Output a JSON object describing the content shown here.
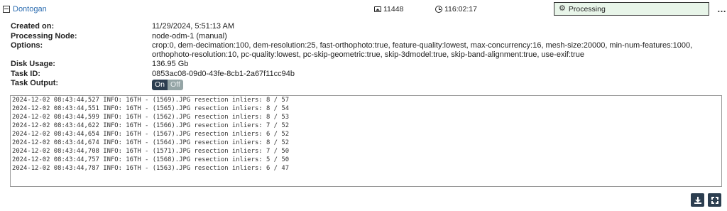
{
  "header": {
    "task_name": "Dontogan",
    "images_count": "11448",
    "elapsed": "116:02:17",
    "status": "Processing",
    "more_icon": "…"
  },
  "details": {
    "created_label": "Created on:",
    "created_value": "11/29/2024, 5:51:13 AM",
    "node_label": "Processing Node:",
    "node_value": "node-odm-1 (manual)",
    "options_label": "Options:",
    "options_value": "crop:0, dem-decimation:100, dem-resolution:25, fast-orthophoto:true, feature-quality:lowest, max-concurrency:16, mesh-size:20000, min-num-features:1000, orthophoto-resolution:10, pc-quality:lowest, pc-skip-geometric:true, skip-3dmodel:true, skip-band-alignment:true, use-exif:true",
    "disk_label": "Disk Usage:",
    "disk_value": "136.95 Gb",
    "taskid_label": "Task ID:",
    "taskid_value": "0853ac08-09d0-43fe-8cb1-2a67f11cc94b",
    "output_label": "Task Output:",
    "toggle_on": "On",
    "toggle_off": "Off"
  },
  "console": {
    "lines": [
      "2024-12-02 08:43:44,527 INFO: 16TH - (1569).JPG resection inliers: 8 / 57",
      "2024-12-02 08:43:44,551 INFO: 16TH - (1565).JPG resection inliers: 8 / 54",
      "2024-12-02 08:43:44,599 INFO: 16TH - (1562).JPG resection inliers: 8 / 53",
      "2024-12-02 08:43:44,622 INFO: 16TH - (1566).JPG resection inliers: 7 / 52",
      "2024-12-02 08:43:44,654 INFO: 16TH - (1567).JPG resection inliers: 6 / 52",
      "2024-12-02 08:43:44,674 INFO: 16TH - (1564).JPG resection inliers: 8 / 52",
      "2024-12-02 08:43:44,708 INFO: 16TH - (1571).JPG resection inliers: 7 / 50",
      "2024-12-02 08:43:44,757 INFO: 16TH - (1568).JPG resection inliers: 5 / 50",
      "2024-12-02 08:43:44,787 INFO: 16TH - (1563).JPG resection inliers: 6 / 47"
    ]
  },
  "colors": {
    "link": "#2b6cb0",
    "status_bg": "#e8f5e9",
    "toggle_on_bg": "#2c3e50",
    "toggle_off_bg": "#95a5a6",
    "button_bg": "#2c3e50"
  },
  "icons": {
    "collapse": "collapse-icon",
    "images": "image-icon",
    "time": "clock-icon",
    "status": "gear-icon",
    "more": "more-icon",
    "download": "download-icon",
    "fullscreen": "expand-icon"
  }
}
